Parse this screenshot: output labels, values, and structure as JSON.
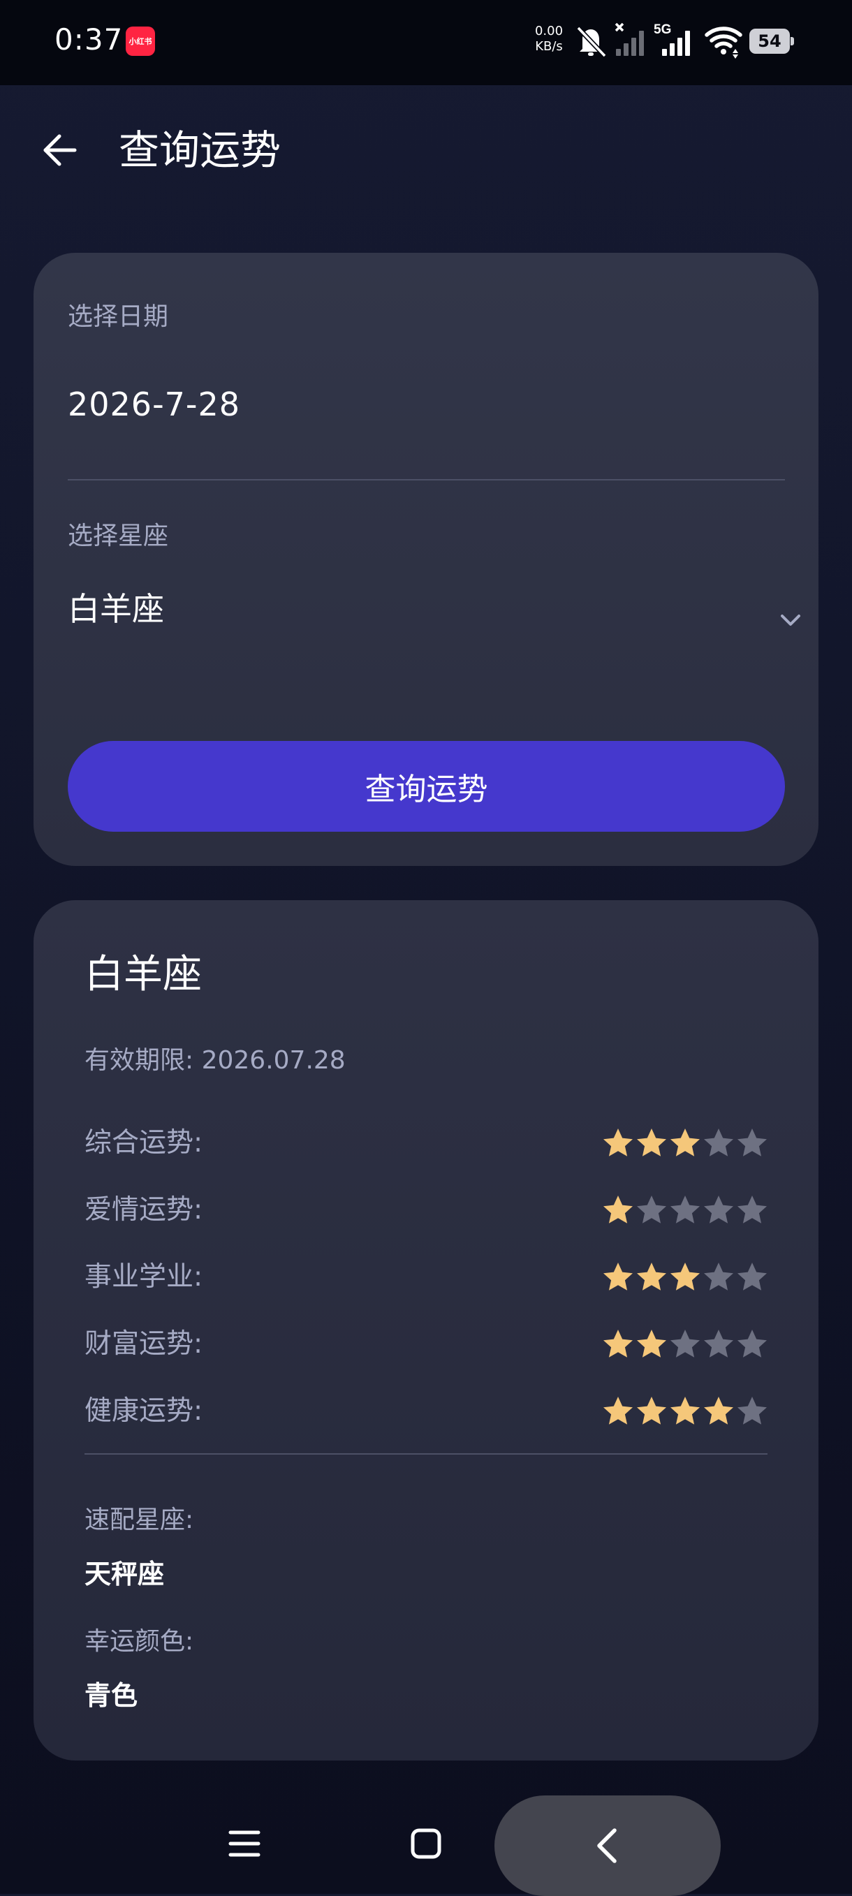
{
  "status_bar": {
    "time": "0:37",
    "app_badge": "小红书",
    "net_speed_value": "0.00",
    "net_speed_unit": "KB/s",
    "network_label": "5G",
    "battery": "54",
    "icons": [
      "mute-bell-icon",
      "no-signal-icon",
      "signal-5g-icon",
      "wifi-icon",
      "battery-icon"
    ]
  },
  "header": {
    "title": "查询运势",
    "back_icon": "arrow-left-icon"
  },
  "form": {
    "date_label": "选择日期",
    "date_value": "2026-7-28",
    "sign_label": "选择星座",
    "sign_value": "白羊座",
    "dropdown_icon": "chevron-down-icon",
    "submit_label": "查询运势"
  },
  "result": {
    "sign": "白羊座",
    "validity": "有效期限: 2026.07.28",
    "max_stars": 5,
    "fortunes": [
      {
        "label": "综合运势:",
        "stars": 3
      },
      {
        "label": "爱情运势:",
        "stars": 1
      },
      {
        "label": "事业学业:",
        "stars": 3
      },
      {
        "label": "财富运势:",
        "stars": 2
      },
      {
        "label": "健康运势:",
        "stars": 4
      }
    ],
    "match_label": "速配星座:",
    "match_value": "天秤座",
    "color_label": "幸运颜色:",
    "color_value": "青色"
  },
  "colors": {
    "accent": "#4538CD",
    "star_filled": "#F5C77A",
    "star_empty": "#6E7182",
    "card_bg": "#2F3245",
    "label_text": "#A6ABC5"
  },
  "nav_bar": {
    "icons": [
      "menu-icon",
      "home-square-icon",
      "back-chevron-icon"
    ]
  }
}
